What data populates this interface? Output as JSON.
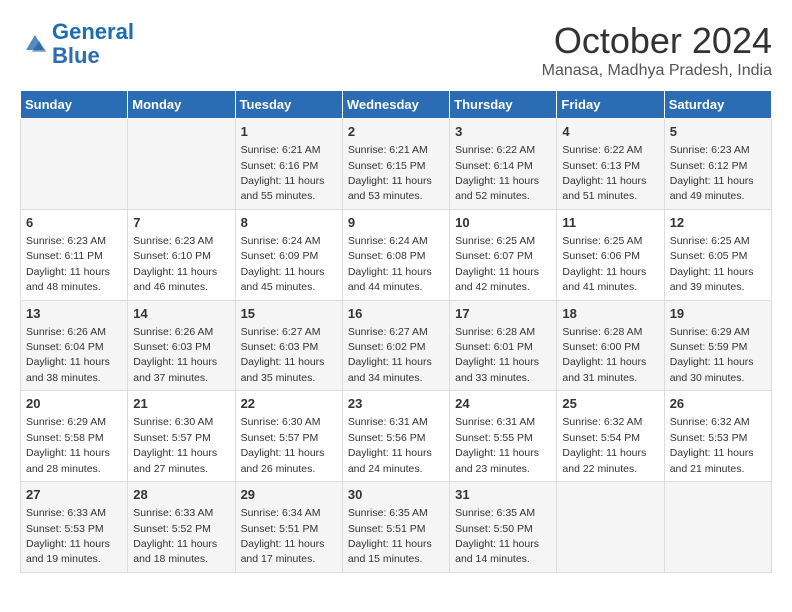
{
  "header": {
    "logo_line1": "General",
    "logo_line2": "Blue",
    "month": "October 2024",
    "location": "Manasa, Madhya Pradesh, India"
  },
  "weekdays": [
    "Sunday",
    "Monday",
    "Tuesday",
    "Wednesday",
    "Thursday",
    "Friday",
    "Saturday"
  ],
  "weeks": [
    [
      {
        "day": "",
        "sunrise": "",
        "sunset": "",
        "daylight": ""
      },
      {
        "day": "",
        "sunrise": "",
        "sunset": "",
        "daylight": ""
      },
      {
        "day": "1",
        "sunrise": "Sunrise: 6:21 AM",
        "sunset": "Sunset: 6:16 PM",
        "daylight": "Daylight: 11 hours and 55 minutes."
      },
      {
        "day": "2",
        "sunrise": "Sunrise: 6:21 AM",
        "sunset": "Sunset: 6:15 PM",
        "daylight": "Daylight: 11 hours and 53 minutes."
      },
      {
        "day": "3",
        "sunrise": "Sunrise: 6:22 AM",
        "sunset": "Sunset: 6:14 PM",
        "daylight": "Daylight: 11 hours and 52 minutes."
      },
      {
        "day": "4",
        "sunrise": "Sunrise: 6:22 AM",
        "sunset": "Sunset: 6:13 PM",
        "daylight": "Daylight: 11 hours and 51 minutes."
      },
      {
        "day": "5",
        "sunrise": "Sunrise: 6:23 AM",
        "sunset": "Sunset: 6:12 PM",
        "daylight": "Daylight: 11 hours and 49 minutes."
      }
    ],
    [
      {
        "day": "6",
        "sunrise": "Sunrise: 6:23 AM",
        "sunset": "Sunset: 6:11 PM",
        "daylight": "Daylight: 11 hours and 48 minutes."
      },
      {
        "day": "7",
        "sunrise": "Sunrise: 6:23 AM",
        "sunset": "Sunset: 6:10 PM",
        "daylight": "Daylight: 11 hours and 46 minutes."
      },
      {
        "day": "8",
        "sunrise": "Sunrise: 6:24 AM",
        "sunset": "Sunset: 6:09 PM",
        "daylight": "Daylight: 11 hours and 45 minutes."
      },
      {
        "day": "9",
        "sunrise": "Sunrise: 6:24 AM",
        "sunset": "Sunset: 6:08 PM",
        "daylight": "Daylight: 11 hours and 44 minutes."
      },
      {
        "day": "10",
        "sunrise": "Sunrise: 6:25 AM",
        "sunset": "Sunset: 6:07 PM",
        "daylight": "Daylight: 11 hours and 42 minutes."
      },
      {
        "day": "11",
        "sunrise": "Sunrise: 6:25 AM",
        "sunset": "Sunset: 6:06 PM",
        "daylight": "Daylight: 11 hours and 41 minutes."
      },
      {
        "day": "12",
        "sunrise": "Sunrise: 6:25 AM",
        "sunset": "Sunset: 6:05 PM",
        "daylight": "Daylight: 11 hours and 39 minutes."
      }
    ],
    [
      {
        "day": "13",
        "sunrise": "Sunrise: 6:26 AM",
        "sunset": "Sunset: 6:04 PM",
        "daylight": "Daylight: 11 hours and 38 minutes."
      },
      {
        "day": "14",
        "sunrise": "Sunrise: 6:26 AM",
        "sunset": "Sunset: 6:03 PM",
        "daylight": "Daylight: 11 hours and 37 minutes."
      },
      {
        "day": "15",
        "sunrise": "Sunrise: 6:27 AM",
        "sunset": "Sunset: 6:03 PM",
        "daylight": "Daylight: 11 hours and 35 minutes."
      },
      {
        "day": "16",
        "sunrise": "Sunrise: 6:27 AM",
        "sunset": "Sunset: 6:02 PM",
        "daylight": "Daylight: 11 hours and 34 minutes."
      },
      {
        "day": "17",
        "sunrise": "Sunrise: 6:28 AM",
        "sunset": "Sunset: 6:01 PM",
        "daylight": "Daylight: 11 hours and 33 minutes."
      },
      {
        "day": "18",
        "sunrise": "Sunrise: 6:28 AM",
        "sunset": "Sunset: 6:00 PM",
        "daylight": "Daylight: 11 hours and 31 minutes."
      },
      {
        "day": "19",
        "sunrise": "Sunrise: 6:29 AM",
        "sunset": "Sunset: 5:59 PM",
        "daylight": "Daylight: 11 hours and 30 minutes."
      }
    ],
    [
      {
        "day": "20",
        "sunrise": "Sunrise: 6:29 AM",
        "sunset": "Sunset: 5:58 PM",
        "daylight": "Daylight: 11 hours and 28 minutes."
      },
      {
        "day": "21",
        "sunrise": "Sunrise: 6:30 AM",
        "sunset": "Sunset: 5:57 PM",
        "daylight": "Daylight: 11 hours and 27 minutes."
      },
      {
        "day": "22",
        "sunrise": "Sunrise: 6:30 AM",
        "sunset": "Sunset: 5:57 PM",
        "daylight": "Daylight: 11 hours and 26 minutes."
      },
      {
        "day": "23",
        "sunrise": "Sunrise: 6:31 AM",
        "sunset": "Sunset: 5:56 PM",
        "daylight": "Daylight: 11 hours and 24 minutes."
      },
      {
        "day": "24",
        "sunrise": "Sunrise: 6:31 AM",
        "sunset": "Sunset: 5:55 PM",
        "daylight": "Daylight: 11 hours and 23 minutes."
      },
      {
        "day": "25",
        "sunrise": "Sunrise: 6:32 AM",
        "sunset": "Sunset: 5:54 PM",
        "daylight": "Daylight: 11 hours and 22 minutes."
      },
      {
        "day": "26",
        "sunrise": "Sunrise: 6:32 AM",
        "sunset": "Sunset: 5:53 PM",
        "daylight": "Daylight: 11 hours and 21 minutes."
      }
    ],
    [
      {
        "day": "27",
        "sunrise": "Sunrise: 6:33 AM",
        "sunset": "Sunset: 5:53 PM",
        "daylight": "Daylight: 11 hours and 19 minutes."
      },
      {
        "day": "28",
        "sunrise": "Sunrise: 6:33 AM",
        "sunset": "Sunset: 5:52 PM",
        "daylight": "Daylight: 11 hours and 18 minutes."
      },
      {
        "day": "29",
        "sunrise": "Sunrise: 6:34 AM",
        "sunset": "Sunset: 5:51 PM",
        "daylight": "Daylight: 11 hours and 17 minutes."
      },
      {
        "day": "30",
        "sunrise": "Sunrise: 6:35 AM",
        "sunset": "Sunset: 5:51 PM",
        "daylight": "Daylight: 11 hours and 15 minutes."
      },
      {
        "day": "31",
        "sunrise": "Sunrise: 6:35 AM",
        "sunset": "Sunset: 5:50 PM",
        "daylight": "Daylight: 11 hours and 14 minutes."
      },
      {
        "day": "",
        "sunrise": "",
        "sunset": "",
        "daylight": ""
      },
      {
        "day": "",
        "sunrise": "",
        "sunset": "",
        "daylight": ""
      }
    ]
  ]
}
